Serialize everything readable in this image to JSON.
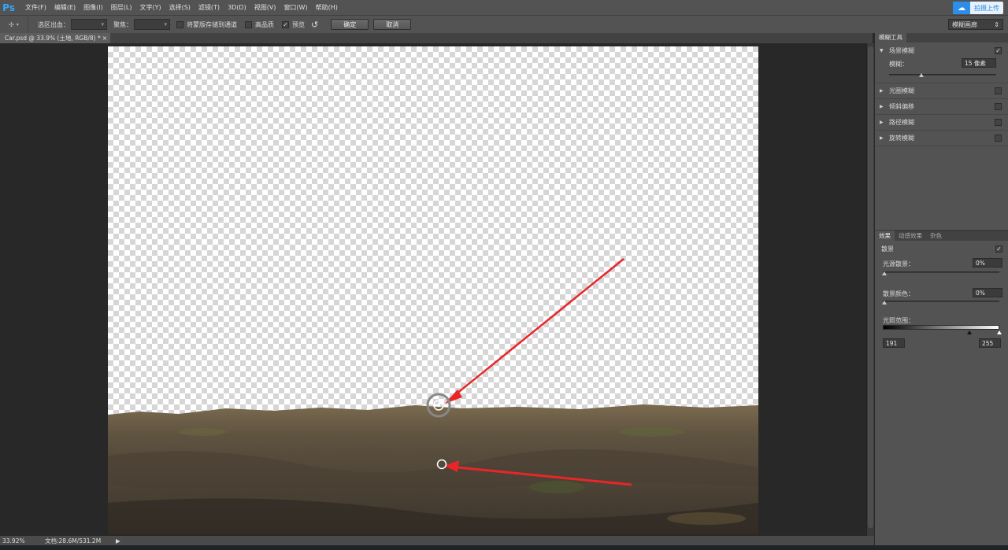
{
  "app": {
    "logo": "Ps"
  },
  "menu": [
    "文件(F)",
    "编辑(E)",
    "图像(I)",
    "图层(L)",
    "文字(Y)",
    "选择(S)",
    "滤镜(T)",
    "3D(D)",
    "视图(V)",
    "窗口(W)",
    "帮助(H)"
  ],
  "cloud": {
    "label": "拍摄上传"
  },
  "options": {
    "selection_out_label": "选区出血：",
    "focus_label": "聚焦：",
    "save_mask_label": "将蒙版存储到通道",
    "high_quality_label": "高品质",
    "preview_label": "预览",
    "ok_label": "确定",
    "cancel_label": "取消",
    "workspace": "模糊画廊"
  },
  "document": {
    "tab_title": "Car.psd @ 33.9% (土地, RGB/8) *",
    "close": "×"
  },
  "status": {
    "zoom": "33.92%",
    "doc_info": "文档:28.6M/531.2M",
    "arrow": "▶"
  },
  "blur_tools": {
    "header": "模糊工具",
    "field_blur": {
      "label": "场景模糊",
      "checked": true
    },
    "blur_label": "模糊：",
    "blur_value": "15 像素",
    "blur_level": 0.3,
    "others": [
      {
        "label": "光圈模糊",
        "checked": false
      },
      {
        "label": "倾斜偏移",
        "checked": false
      },
      {
        "label": "路径模糊",
        "checked": false
      },
      {
        "label": "旋转模糊",
        "checked": false
      }
    ]
  },
  "effects": {
    "tabs": [
      "效果",
      "动感效果",
      "杂色"
    ],
    "bokeh_label": "散景",
    "bokeh_checked": true,
    "light_bokeh_label": "光源散景：",
    "light_bokeh_value": "0%",
    "bokeh_color_label": "散景颜色：",
    "bokeh_color_value": "0%",
    "light_range_label": "光照范围：",
    "light_range_low": "191",
    "light_range_high": "255"
  },
  "colors": {
    "accent": "#31a8ff",
    "panel": "#535353",
    "workspace": "#282828",
    "arrow": "#e8262a"
  }
}
